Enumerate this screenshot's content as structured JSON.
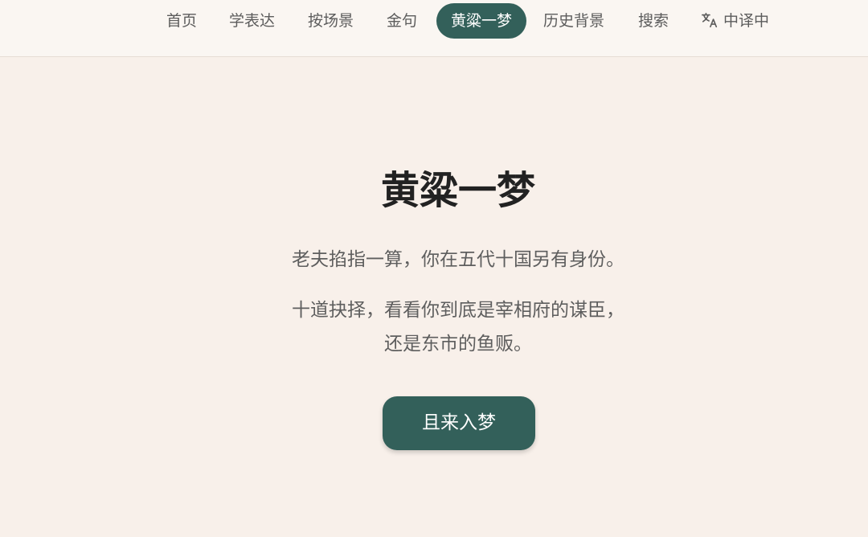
{
  "nav": {
    "items": [
      {
        "label": "首页"
      },
      {
        "label": "学表达"
      },
      {
        "label": "按场景"
      },
      {
        "label": "金句"
      },
      {
        "label": "黄粱一梦",
        "active": true
      },
      {
        "label": "历史背景"
      },
      {
        "label": "搜索"
      }
    ],
    "translate": {
      "label": "中译中",
      "icon": "translate-icon"
    }
  },
  "hero": {
    "title": "黄粱一梦",
    "line1": "老夫掐指一算，你在五代十国另有身份。",
    "line2": "十道抉择，看看你到底是宰相府的谋臣，",
    "line3": "还是东市的鱼贩。",
    "cta_label": "且来入梦"
  },
  "colors": {
    "accent": "#33605a",
    "background": "#f8f0ea",
    "header_background": "#faf6f2"
  }
}
